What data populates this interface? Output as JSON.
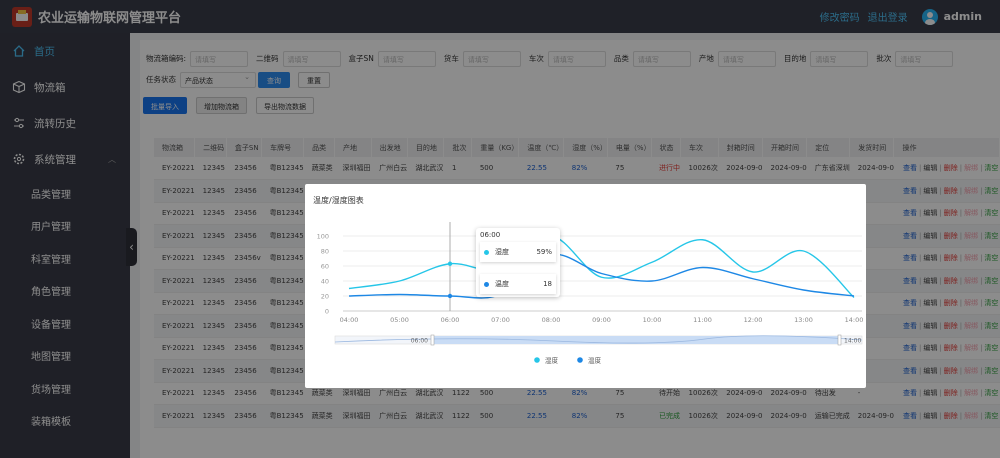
{
  "header": {
    "title": "农业运输物联网管理平台",
    "change_pwd": "修改密码",
    "logout": "退出登录",
    "username": "admin"
  },
  "sidebar": {
    "items": [
      {
        "label": "首页",
        "icon": "home-icon"
      },
      {
        "label": "物流箱",
        "icon": "box-icon"
      },
      {
        "label": "流转历史",
        "icon": "sliders-icon"
      },
      {
        "label": "系统管理",
        "icon": "gear-icon"
      }
    ],
    "subitems": [
      "品类管理",
      "用户管理",
      "科室管理",
      "角色管理",
      "设备管理",
      "地图管理",
      "货场管理",
      "装箱模板"
    ]
  },
  "filters": {
    "box_code": "物流箱编码:",
    "qr": "二维码",
    "box_sn": "盒子SN",
    "truck": "货车",
    "trip": "车次",
    "category": "品类",
    "origin": "产地",
    "destination": "目的地",
    "batch": "批次",
    "task_status": "任务状态",
    "placeholder": "请填写",
    "status_select": "产品状态",
    "query": "查询",
    "reset": "重置"
  },
  "actions": {
    "batch_import": "批量导入",
    "add_box": "增加物流箱",
    "export": "导出物流数据"
  },
  "table": {
    "headers": [
      "物流箱",
      "二维码",
      "盒子SN",
      "车牌号",
      "品类",
      "产地",
      "出发地",
      "目的地",
      "批次",
      "重量（KG）",
      "温度（℃）",
      "湿度（%）",
      "电量（%）",
      "状态",
      "车次",
      "封箱时间",
      "开箱时间",
      "定位",
      "发货时间",
      "操作"
    ],
    "ops": {
      "view": "查看",
      "edit": "编辑",
      "delete": "删除",
      "unbind": "解绑",
      "clear": "清空",
      "sep": "|"
    },
    "rows": [
      [
        "EY-20221",
        "12345",
        "23456",
        "粤B12345",
        "蔬菜类",
        "深圳福田",
        "广州白云",
        "湖北武汉",
        "1",
        "500",
        "22.55",
        "82%",
        "75",
        "进行中",
        "10026次",
        "2024-09-0",
        "2024-09-0",
        "广东省深圳",
        "2024-09-0"
      ],
      [
        "EY-20221",
        "12345",
        "23456",
        "粤B12345",
        "",
        "",
        "",
        "",
        "",
        "",
        "",
        "",
        "",
        "",
        "",
        "",
        "",
        "",
        ""
      ],
      [
        "EY-20221",
        "12345",
        "23456",
        "粤B12345",
        "",
        "",
        "",
        "",
        "",
        "",
        "",
        "",
        "",
        "",
        "",
        "",
        "",
        "",
        ""
      ],
      [
        "EY-20221",
        "12345",
        "23456",
        "粤B12345",
        "",
        "",
        "",
        "",
        "",
        "",
        "",
        "",
        "",
        "",
        "",
        "",
        "",
        "",
        ""
      ],
      [
        "EY-20221",
        "12345",
        "23456v",
        "粤B12345",
        "",
        "",
        "",
        "",
        "",
        "",
        "",
        "",
        "",
        "",
        "",
        "",
        "",
        "",
        ""
      ],
      [
        "EY-20221",
        "12345",
        "23456",
        "粤B12345",
        "",
        "",
        "",
        "",
        "",
        "",
        "",
        "",
        "",
        "",
        "",
        "",
        "",
        "",
        ""
      ],
      [
        "EY-20221",
        "12345",
        "23456",
        "粤B12345",
        "",
        "",
        "",
        "",
        "",
        "",
        "",
        "",
        "",
        "",
        "",
        "",
        "",
        "",
        ""
      ],
      [
        "EY-20221",
        "12345",
        "23456",
        "粤B12345",
        "",
        "",
        "",
        "",
        "",
        "",
        "",
        "",
        "",
        "",
        "",
        "",
        "",
        "",
        ""
      ],
      [
        "EY-20221",
        "12345",
        "23456",
        "粤B12345",
        "",
        "",
        "",
        "",
        "",
        "",
        "",
        "",
        "",
        "",
        "",
        "",
        "",
        "",
        ""
      ],
      [
        "EY-20221",
        "12345",
        "23456",
        "粤B12345",
        "",
        "",
        "",
        "",
        "",
        "",
        "",
        "",
        "",
        "",
        "",
        "",
        "",
        "",
        ""
      ],
      [
        "EY-20221",
        "12345",
        "23456",
        "粤B12345",
        "蔬菜类",
        "深圳福田",
        "广州白云",
        "湖北武汉",
        "1122",
        "500",
        "22.55",
        "82%",
        "75",
        "待开始",
        "10026次",
        "2024-09-0",
        "2024-09-0",
        "待出发",
        "-"
      ],
      [
        "EY-20221",
        "12345",
        "23456",
        "粤B12345",
        "蔬菜类",
        "深圳福田",
        "广州白云",
        "湖北武汉",
        "1122",
        "500",
        "22.55",
        "82%",
        "75",
        "已完成",
        "10026次",
        "2024-09-0",
        "2024-09-0",
        "运输已完成",
        "2024-09-0"
      ]
    ]
  },
  "modal": {
    "title": "温度/湿度图表",
    "tooltip_time": "06:00",
    "tooltip": [
      {
        "name": "湿度",
        "value": "59%"
      },
      {
        "name": "温度",
        "value": "18"
      }
    ],
    "zoom_start": "06:00",
    "zoom_end": "14:00"
  },
  "chart_data": {
    "type": "line",
    "title": "温度/湿度图表",
    "x": [
      "04:00",
      "05:00",
      "06:00",
      "07:00",
      "08:00",
      "09:00",
      "10:00",
      "11:00",
      "12:00",
      "13:00",
      "14:00"
    ],
    "series": [
      {
        "name": "湿度",
        "values": [
          30,
          40,
          63,
          55,
          100,
          45,
          65,
          95,
          52,
          80,
          18
        ],
        "color": "#26c6e8"
      },
      {
        "name": "温度",
        "values": [
          20,
          22,
          20,
          22,
          75,
          50,
          40,
          58,
          43,
          28,
          20
        ],
        "color": "#1e88e5"
      }
    ],
    "yticks": [
      0,
      20,
      40,
      60,
      80,
      100
    ],
    "ylim": [
      0,
      100
    ],
    "tooltip_x": "06:00",
    "legend_position": "bottom"
  },
  "colors": {
    "accent": "#2d8cf0",
    "sidebar": "#393b47",
    "header": "#3a3d4a",
    "humidity": "#26c6e8",
    "temperature": "#1e88e5"
  }
}
